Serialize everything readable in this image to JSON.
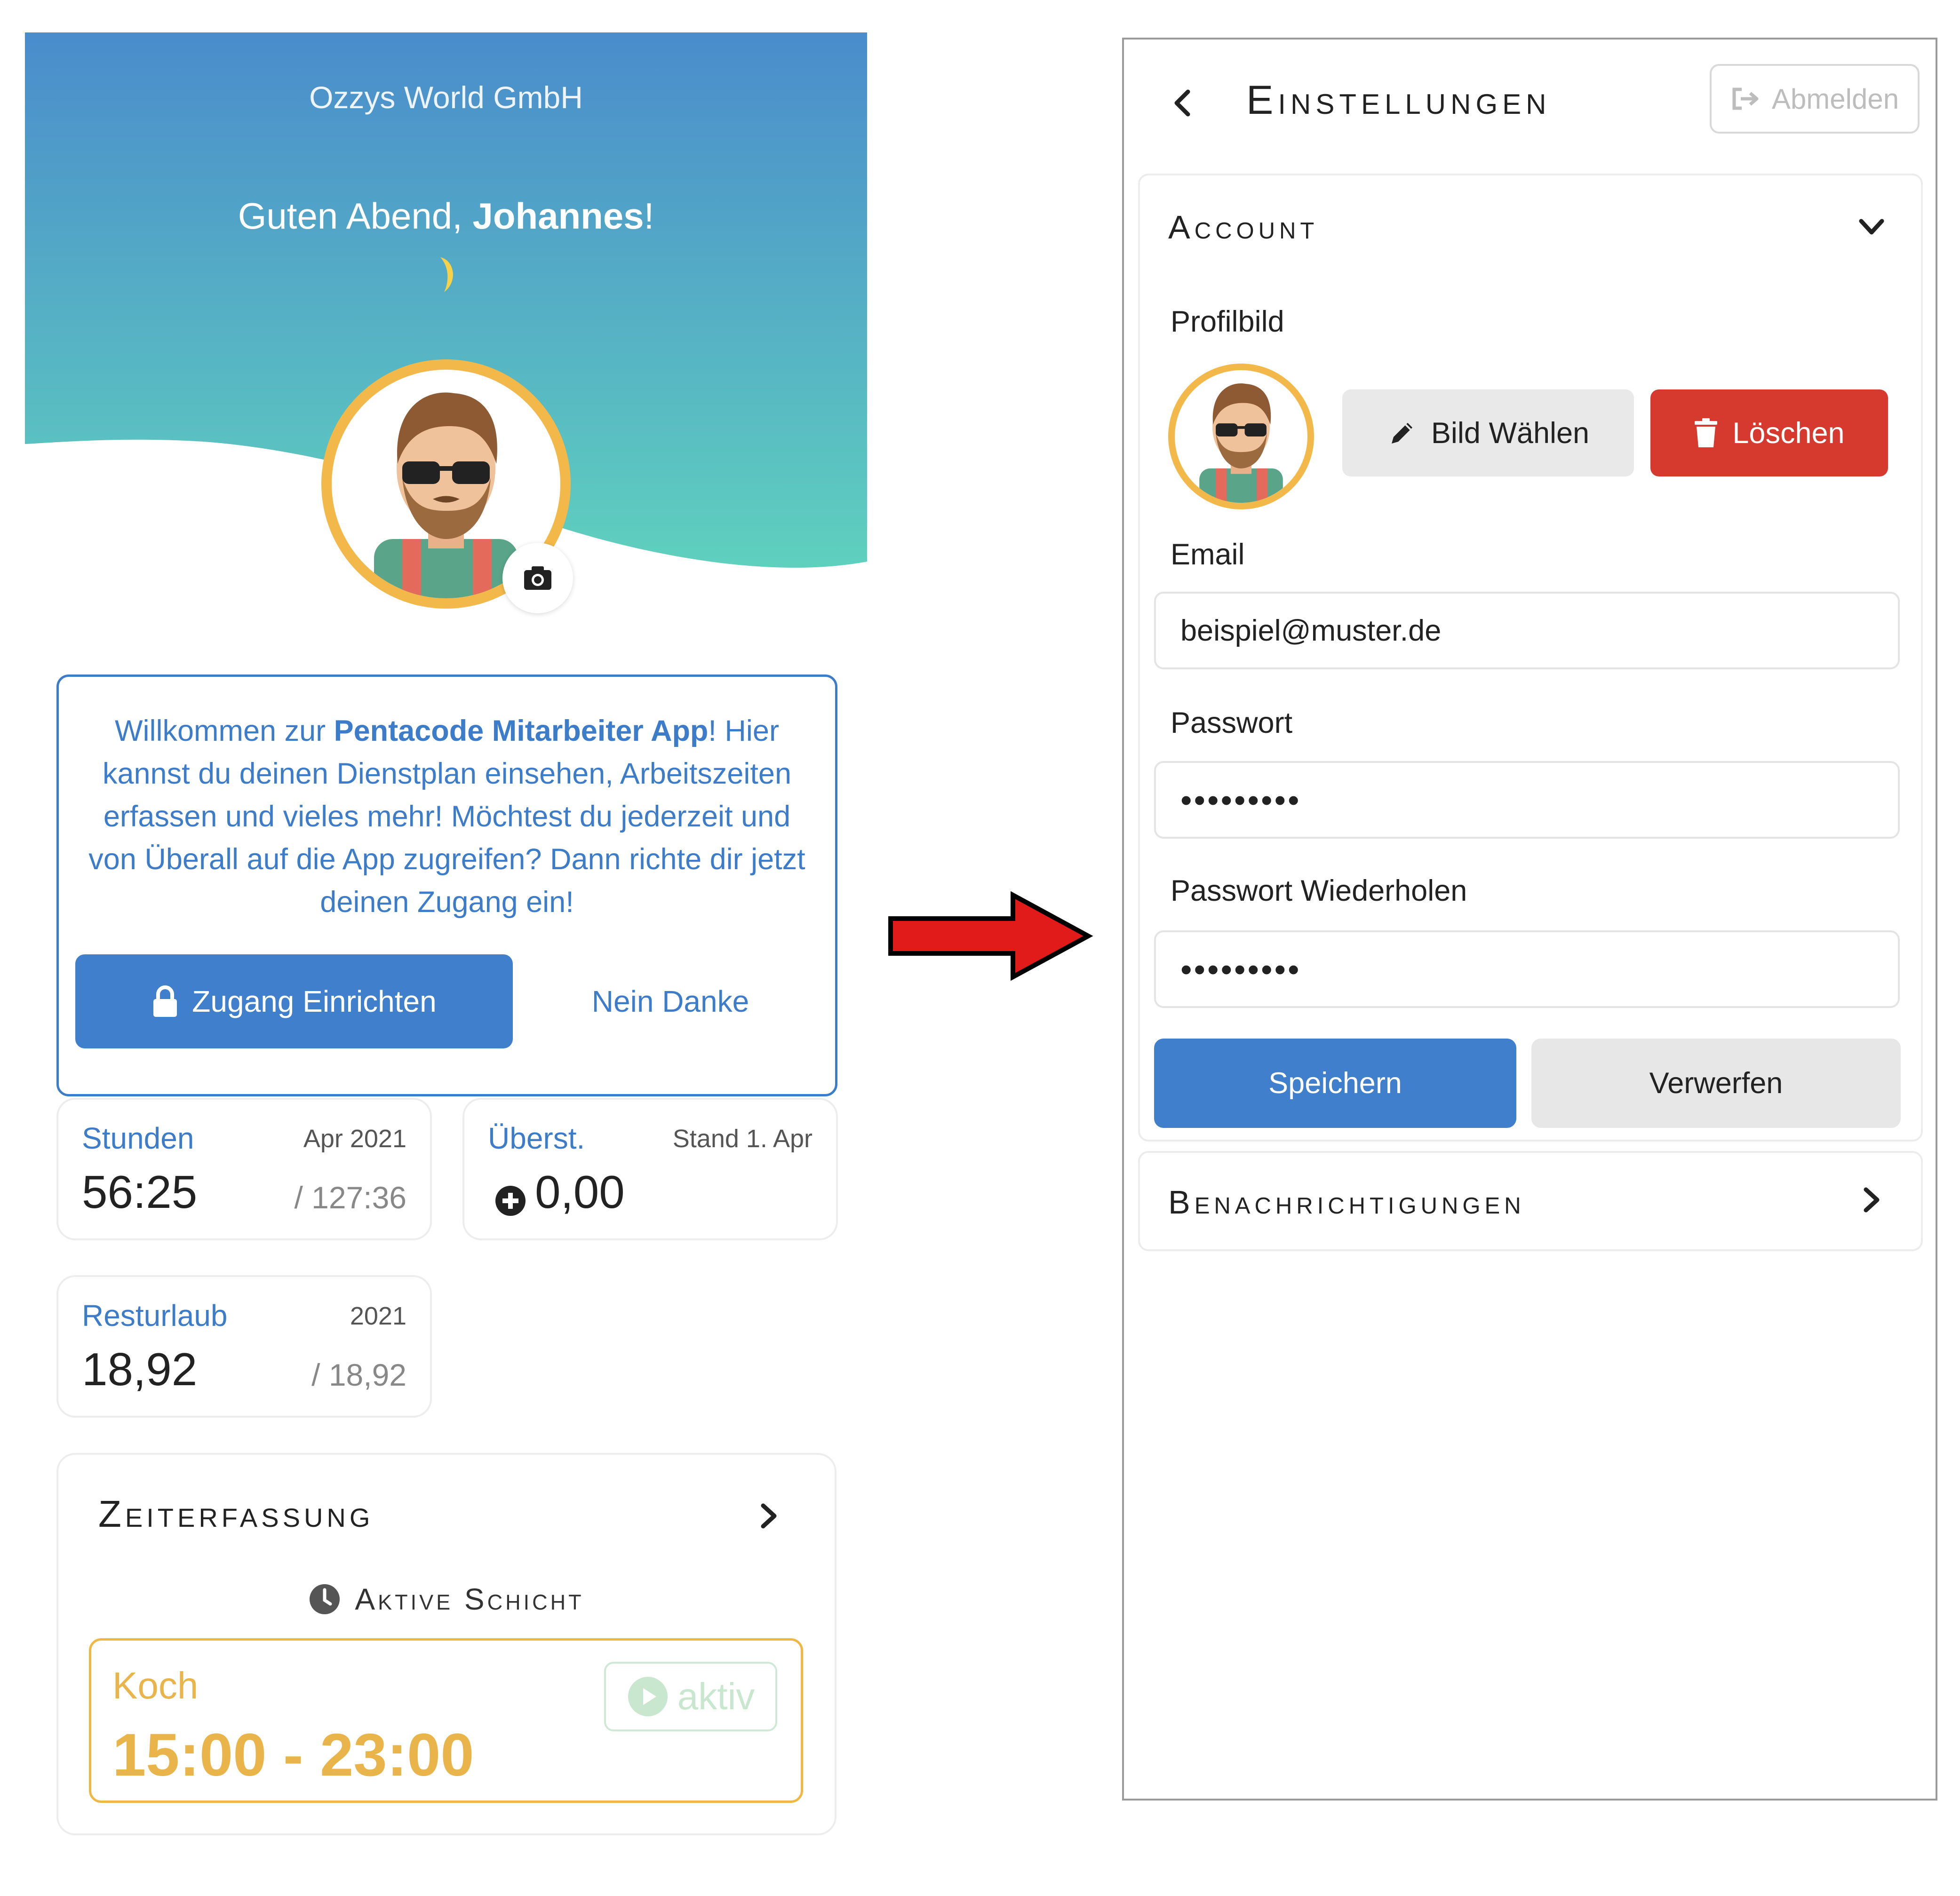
{
  "home": {
    "company": "Ozzys World GmbH",
    "greeting_prefix": "Guten Abend, ",
    "greeting_name": "Johannes",
    "greeting_suffix": "!",
    "welcome": {
      "text_before": "Willkommen zur ",
      "app_name": "Pentacode Mitarbeiter App",
      "text_after": "! Hier kannst du deinen Dienstplan einsehen, Arbeitszeiten erfassen und vieles mehr! Möchtest du jederzeit und von Überall auf die App zugreifen? Dann richte dir jetzt deinen Zugang ein!",
      "primary_label": "Zugang Einrichten",
      "secondary_label": "Nein Danke"
    },
    "cards": {
      "stunden": {
        "title": "Stunden",
        "period": "Apr 2021",
        "value": "56:25",
        "total": "/ 127:36"
      },
      "ueberstunden": {
        "title": "Überst.",
        "period": "Stand 1. Apr",
        "value": "0,00"
      },
      "resturlaub": {
        "title": "Resturlaub",
        "period": "2021",
        "value": "18,92",
        "total": "/ 18,92"
      }
    },
    "zeiterfassung": {
      "title": "Zeiterfassung",
      "active_label": "Aktive Schicht",
      "shift_role": "Koch",
      "shift_time": "15:00 - 23:00",
      "status": "aktiv"
    }
  },
  "settings": {
    "title": "Einstellungen",
    "logout_label": "Abmelden",
    "account": {
      "title": "Account",
      "profile_label": "Profilbild",
      "choose_image_label": "Bild Wählen",
      "delete_label": "Löschen",
      "email_label": "Email",
      "email_value": "beispiel@muster.de",
      "password_label": "Passwort",
      "password_value": "•••••••••",
      "password_repeat_label": "Passwort Wiederholen",
      "password_repeat_value": "•••••••••",
      "save_label": "Speichern",
      "discard_label": "Verwerfen"
    },
    "notifications": {
      "title": "Benachrichtigungen"
    }
  },
  "colors": {
    "primary_blue": "#3f7fcb",
    "header_top": "#4a8ccc",
    "header_bottom": "#5fd0be",
    "accent_yellow": "#e9b44a",
    "danger_red": "#d63a2f",
    "arrow_red": "#e11a1a"
  },
  "icons": [
    "moon-icon",
    "camera-icon",
    "lock-icon",
    "plus-circle-icon",
    "chevron-right-icon",
    "clock-icon",
    "play-icon",
    "chevron-left-icon",
    "logout-icon",
    "chevron-down-icon",
    "pencil-icon",
    "trash-icon",
    "arrow-right-icon"
  ]
}
